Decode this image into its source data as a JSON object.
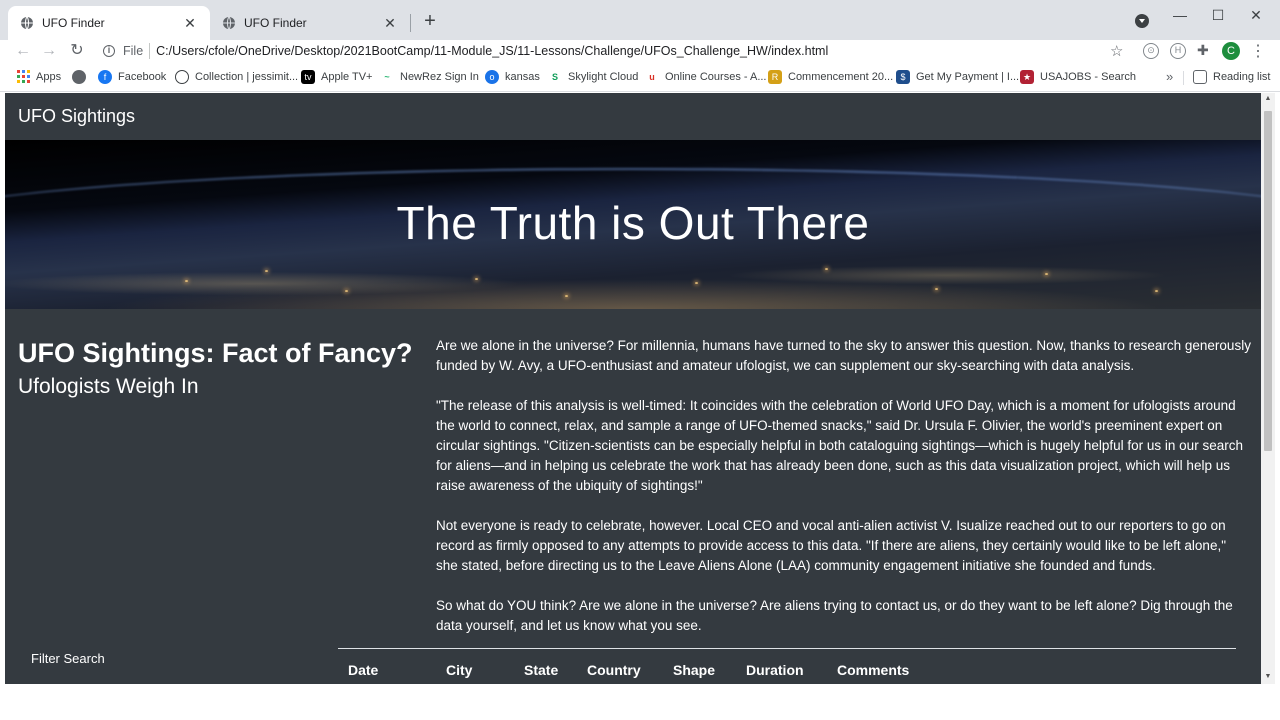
{
  "browser": {
    "tabs": [
      {
        "title": "UFO Finder",
        "active": true
      },
      {
        "title": "UFO Finder",
        "active": false
      }
    ],
    "url_scheme": "File",
    "url": "C:/Users/cfole/OneDrive/Desktop/2021BootCamp/11-Module_JS/11-Lessons/Challenge/UFOs_Challenge_HW/index.html",
    "profile_initial": "C",
    "bookmarks": [
      {
        "label": "Apps",
        "icon": "apps-grid-icon"
      },
      {
        "label": "",
        "icon": "globe-icon"
      },
      {
        "label": "Facebook",
        "icon": "facebook-icon"
      },
      {
        "label": "Collection | jessimit...",
        "icon": "collection-icon"
      },
      {
        "label": "Apple TV+",
        "icon": "apple-tv-icon"
      },
      {
        "label": "NewRez Sign In",
        "icon": "newrez-icon"
      },
      {
        "label": "kansas",
        "icon": "kansas-icon"
      },
      {
        "label": "Skylight Cloud",
        "icon": "skylight-icon"
      },
      {
        "label": "Online Courses - A...",
        "icon": "online-courses-icon"
      },
      {
        "label": "Commencement 20...",
        "icon": "commencement-icon"
      },
      {
        "label": "Get My Payment | I...",
        "icon": "payment-icon"
      },
      {
        "label": "USAJOBS - Search",
        "icon": "usajobs-icon"
      }
    ],
    "more_bookmarks": "»",
    "reading_list": "Reading list"
  },
  "page": {
    "brand": "UFO Sightings",
    "hero_title": "The Truth is Out There",
    "article_heading": "UFO Sightings: Fact of Fancy?",
    "article_subheading": "Ufologists Weigh In",
    "paragraphs": [
      "Are we alone in the universe? For millennia, humans have turned to the sky to answer this question. Now, thanks to research generously funded by W. Avy, a UFO-enthusiast and amateur ufologist, we can supplement our sky-searching with data analysis.",
      "\"The release of this analysis is well-timed: It coincides with the celebration of World UFO Day, which is a moment for ufologists around the world to connect, relax, and sample a range of UFO-themed snacks,\" said Dr. Ursula F. Olivier, the world's preeminent expert on circular sightings. \"Citizen-scientists can be especially helpful in both cataloguing sightings—which is hugely helpful for us in our search for aliens—and in helping us celebrate the work that has already been done, such as this data visualization project, which will help us raise awareness of the ubiquity of sightings!\"",
      "Not everyone is ready to celebrate, however. Local CEO and vocal anti-alien activist V. Isualize reached out to our reporters to go on record as firmly opposed to any attempts to provide access to this data. \"If there are aliens, they certainly would like to be left alone,\" she stated, before directing us to the Leave Aliens Alone (LAA) community engagement initiative she founded and funds.",
      "So what do YOU think? Are we alone in the universe? Are aliens trying to contact us, or do they want to be left alone? Dig through the data yourself, and let us know what you see."
    ],
    "filter_label": "Filter Search",
    "table_headers": [
      "Date",
      "City",
      "State",
      "Country",
      "Shape",
      "Duration",
      "Comments"
    ]
  }
}
